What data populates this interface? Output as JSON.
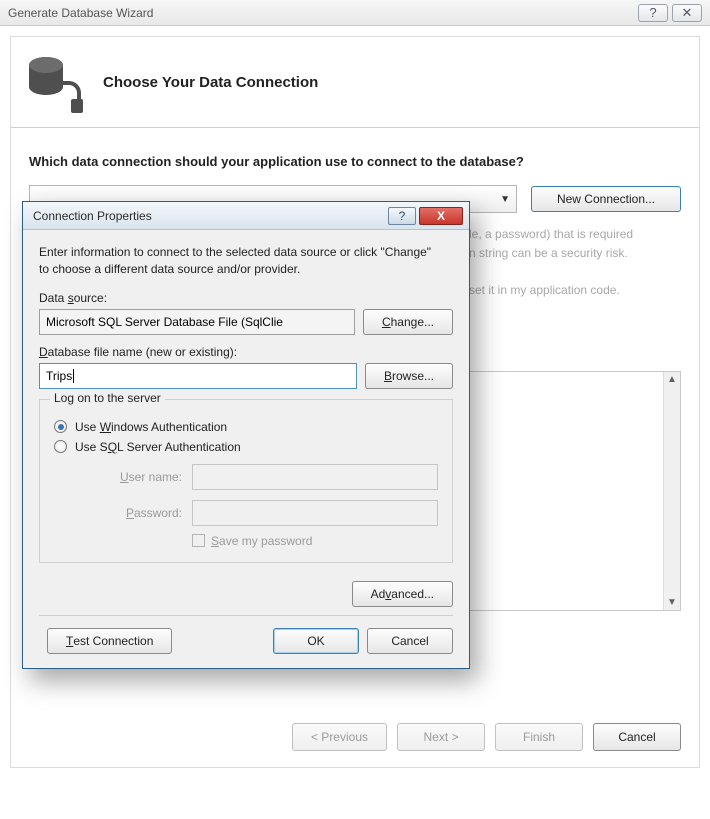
{
  "wizard": {
    "title": "Generate Database Wizard",
    "header": "Choose Your Data Connection",
    "question": "Which data connection should your application use to connect to the database?",
    "new_connection": "New Connection...",
    "info_line1": "le, a password) that is required",
    "info_line2": "n string can be a security risk.",
    "info_line3": "set it in my application code.",
    "previous": "< Previous",
    "next": "Next >",
    "finish": "Finish",
    "cancel": "Cancel"
  },
  "modal": {
    "title": "Connection Properties",
    "intro": "Enter information to connect to the selected data source or click \"Change\" to choose a different data source and/or provider.",
    "data_source_label": "Data source:",
    "data_source_value": "Microsoft SQL Server Database File (SqlClie",
    "change": "Change...",
    "db_file_label": "Database file name (new or existing):",
    "db_file_value": "Trips",
    "browse": "Browse...",
    "logon_legend": "Log on to the server",
    "auth_windows": "Use Windows Authentication",
    "auth_sql": "Use SQL Server Authentication",
    "user_name_label": "User name:",
    "password_label": "Password:",
    "save_pw": "Save my password",
    "advanced": "Advanced...",
    "test": "Test Connection",
    "ok": "OK",
    "cancel": "Cancel"
  }
}
